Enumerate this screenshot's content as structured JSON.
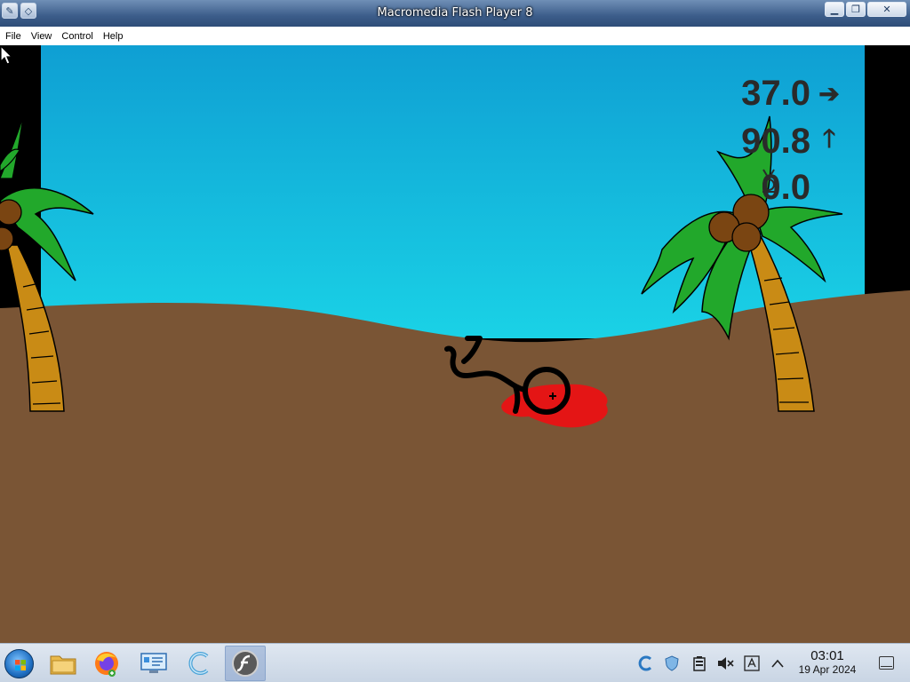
{
  "window": {
    "title": "Macromedia Flash Player 8",
    "controls": {
      "minimize_icon": "minimize-icon",
      "maximize_icon": "maximize-icon",
      "close_icon": "close-icon"
    }
  },
  "menubar": {
    "items": [
      {
        "label": "File"
      },
      {
        "label": "View"
      },
      {
        "label": "Control"
      },
      {
        "label": "Help"
      }
    ]
  },
  "game": {
    "hud": {
      "speed_x": {
        "value": "37.0",
        "icon": "arrow-right-icon"
      },
      "speed_y": {
        "value": "90.8",
        "icon": "arrow-up-icon"
      },
      "score": {
        "value": "0.0",
        "icon": "medal-icon"
      }
    },
    "colors": {
      "sky_top": "#0f9fd3",
      "sky_bottom": "#1ad2e6",
      "sand": "#7a5535",
      "palm_leaf": "#22a82b",
      "palm_trunk": "#c98b15",
      "coconut": "#7a4512",
      "blood": "#e41515",
      "stickman": "#000000",
      "hud_text": "#2a2a2a"
    }
  },
  "taskbar": {
    "start_icon": "windows-start-icon",
    "apps": [
      {
        "name": "file-explorer-icon",
        "active": false
      },
      {
        "name": "firefox-icon",
        "active": false
      },
      {
        "name": "control-panel-icon",
        "active": false
      },
      {
        "name": "ccleaner-icon",
        "active": false
      },
      {
        "name": "flash-player-icon",
        "active": true
      }
    ],
    "tray": {
      "icons": [
        "ccleaner-tray-icon",
        "security-tray-icon",
        "battery-tray-icon",
        "volume-muted-icon",
        "keyboard-tray-icon",
        "chevron-up-icon"
      ],
      "time": "03:01",
      "date": "19 Apr 2024"
    }
  }
}
